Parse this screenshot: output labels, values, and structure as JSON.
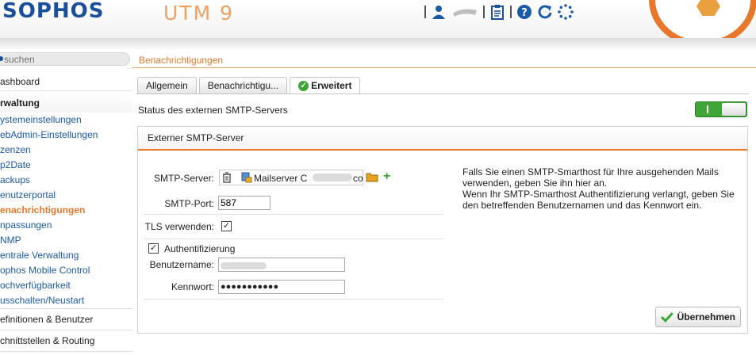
{
  "header": {
    "brand": "SOPHOS",
    "product": "UTM 9",
    "icons": [
      "user-icon",
      "network-icon",
      "clipboard-icon",
      "help-icon",
      "reload-icon",
      "spinner-icon"
    ]
  },
  "colors": {
    "accent": "#e7772a",
    "brand": "#1a4f9c",
    "link": "#1a5aa8",
    "success": "#3ea536"
  },
  "search": {
    "placeholder": "suchen"
  },
  "nav": {
    "dashboard": "ashboard",
    "section": "rwaltung",
    "items": [
      "ystemeinstellungen",
      "ebAdmin-Einstellungen",
      "zenzen",
      "p2Date",
      "ackups",
      "enutzerportal",
      "enachrichtigungen",
      "npassungen",
      "NMP",
      "entrale Verwaltung",
      "ophos Mobile Control",
      "ochverfügbarkeit",
      "usschalten/Neustart"
    ],
    "categories": [
      "efinitionen & Benutzer",
      "chnittstellen & Routing"
    ]
  },
  "page": {
    "title": "Benachrichtigungen",
    "tabs": [
      "Allgemein",
      "Benachrichtigu...",
      "Erweitert"
    ],
    "status_label": "Status des externen SMTP-Servers",
    "panel_title": "Externer SMTP-Server",
    "form": {
      "smtp_server_label": "SMTP-Server:",
      "smtp_server_value": "Mailserver C",
      "smtp_server_suffix": "co",
      "smtp_port_label": "SMTP-Port:",
      "smtp_port_value": "587",
      "tls_label": "TLS verwenden:",
      "auth_label": "Authentifizierung",
      "username_label": "Benutzername:",
      "password_label": "Kennwort:",
      "password_value": "●●●●●●●●●●●"
    },
    "help_lines": [
      "Falls Sie einen SMTP-Smarthost für Ihre ausgehenden Mails",
      "verwenden, geben Sie ihn hier an.",
      "Wenn Ihr SMTP-Smarthost Authentifizierung verlangt, geben Sie",
      "den betreffenden Benutzernamen und das Kennwort ein."
    ],
    "apply_label": "Übernehmen"
  }
}
